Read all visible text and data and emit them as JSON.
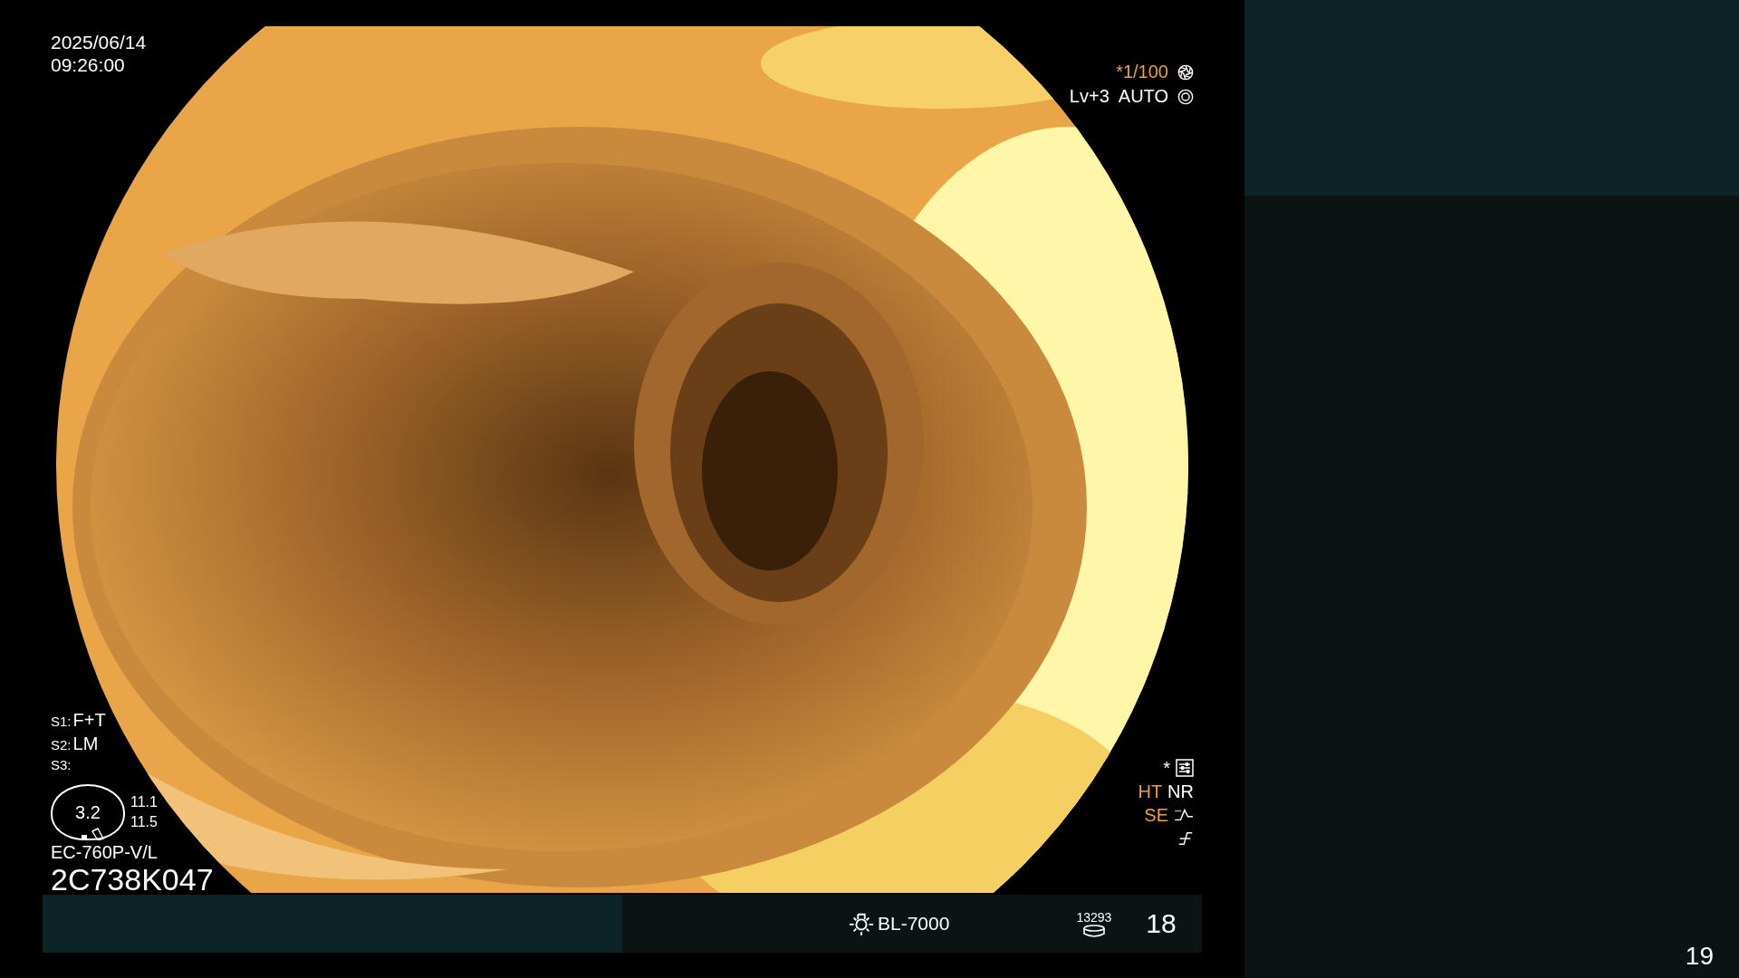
{
  "datetime": {
    "date": "2025/06/14",
    "time": "09:26:00"
  },
  "exposure": {
    "shutter": "*1/100",
    "level": "Lv+3",
    "mode": "AUTO"
  },
  "switches": [
    {
      "label": "S1:",
      "value": "F+T"
    },
    {
      "label": "S2:",
      "value": "LM"
    },
    {
      "label": "S3:"
    }
  ],
  "zoom_gauge": {
    "value": "3.2",
    "readings": [
      "11.1",
      "11.5"
    ]
  },
  "scope": {
    "model": "EC-760P-V/L",
    "serial": "2C738K047"
  },
  "image_settings": {
    "star": "*",
    "modes": [
      {
        "text": "HT",
        "color": "#e8a23a"
      },
      {
        "text": "NR",
        "color": "#ffffff"
      }
    ],
    "enhance": {
      "text": "SE",
      "color": "#e8a23a"
    }
  },
  "status_bar": {
    "light_source": "BL-7000",
    "counter": "13293",
    "number": "18"
  },
  "page_number": "19"
}
